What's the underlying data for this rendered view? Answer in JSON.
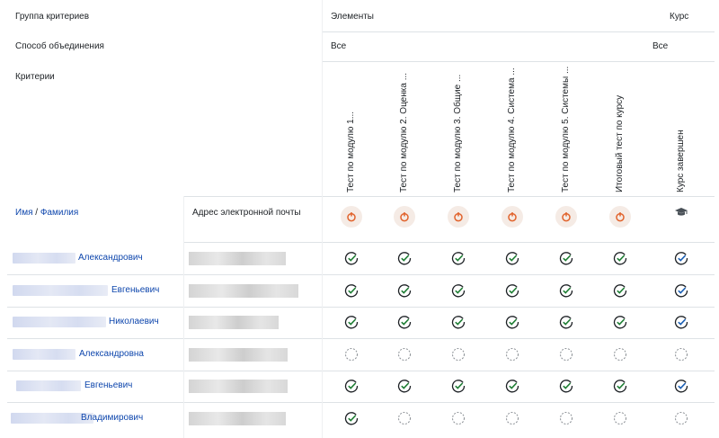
{
  "header": {
    "group_label": "Группа критериев",
    "method_label": "Способ объединения",
    "criteria_label": "Критерии",
    "elements_label": "Элементы",
    "course_label": "Курс",
    "elements_method": "Все",
    "course_method": "Все"
  },
  "criteria": [
    "Тест по модулю 1...",
    "Тест по модулю 2. Оценка ...",
    "Тест по модулю 3. Общие ...",
    "Тест по модулю 4. Система ...",
    "Тест по модулю 5. Системы ...",
    "Итоговый тест по курсу",
    "Курс завершен"
  ],
  "criteria_icons": [
    "quiz-icon",
    "quiz-icon",
    "quiz-icon",
    "quiz-icon",
    "quiz-icon",
    "quiz-icon",
    "graduation-cap-icon"
  ],
  "columns": {
    "name_first": "Имя",
    "name_sep": " / ",
    "name_last": "Фамилия",
    "email": "Адрес электронной почты"
  },
  "rows": [
    {
      "name": "Александрович",
      "statuses": [
        "done",
        "done",
        "done",
        "done",
        "done",
        "done",
        "complete"
      ]
    },
    {
      "name": "Евгеньевич",
      "statuses": [
        "done",
        "done",
        "done",
        "done",
        "done",
        "done",
        "complete"
      ]
    },
    {
      "name": "Николаевич",
      "statuses": [
        "done",
        "done",
        "done",
        "done",
        "done",
        "done",
        "complete"
      ]
    },
    {
      "name": "Александровна",
      "statuses": [
        "pending",
        "pending",
        "pending",
        "pending",
        "pending",
        "pending",
        "pending"
      ]
    },
    {
      "name": "Евгеньевич",
      "statuses": [
        "done",
        "done",
        "done",
        "done",
        "done",
        "done",
        "complete"
      ]
    },
    {
      "name": "Владимирович",
      "statuses": [
        "done",
        "pending",
        "pending",
        "pending",
        "pending",
        "pending",
        "pending"
      ]
    }
  ],
  "colors": {
    "link": "#0f47ad",
    "done_check": "#1e7e34",
    "complete_check": "#1a5fb4",
    "activity_icon": "#e1622b",
    "activity_bg": "#f5ebe5",
    "border": "#dee2e6"
  }
}
